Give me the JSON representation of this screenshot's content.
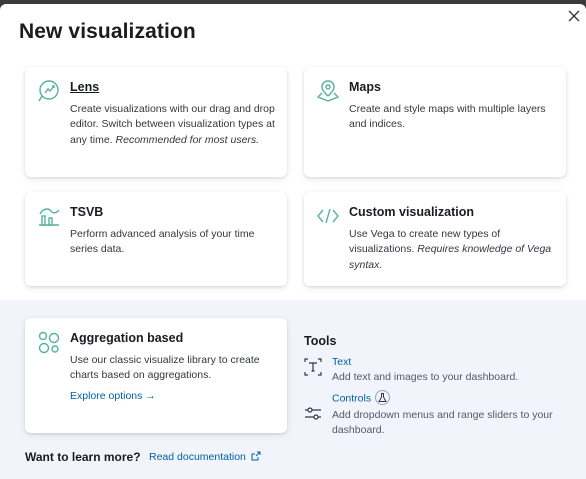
{
  "modal": {
    "title": "New visualization",
    "close_icon": "close-icon"
  },
  "cards": {
    "lens": {
      "title": "Lens",
      "desc_1": "Create visualizations with our drag and drop editor. Switch between visualization types at any time. ",
      "desc_em": "Recommended for most users.",
      "icon": "lens-icon"
    },
    "maps": {
      "title": "Maps",
      "desc": "Create and style maps with multiple layers and indices.",
      "icon": "maps-icon"
    },
    "tsvb": {
      "title": "TSVB",
      "desc": "Perform advanced analysis of your time series data.",
      "icon": "tsvb-icon"
    },
    "custom": {
      "title": "Custom visualization",
      "desc_1": "Use Vega to create new types of visualizations. ",
      "desc_em": "Requires knowledge of Vega syntax.",
      "icon": "code-icon"
    },
    "aggregation": {
      "title": "Aggregation based",
      "desc": "Use our classic visualize library to create charts based on aggregations.",
      "link": "Explore options →",
      "icon": "aggregation-icon"
    }
  },
  "tools": {
    "heading": "Tools",
    "items": [
      {
        "name": "Text",
        "desc": "Add text and images to your dashboard.",
        "icon": "text-icon"
      },
      {
        "name": "Controls",
        "desc": "Add dropdown menus and range sliders to your dashboard.",
        "icon": "controls-icon",
        "badge_icon": "beaker-icon"
      }
    ]
  },
  "footer": {
    "learn_more": "Want to learn more?",
    "read_docs": "Read documentation",
    "external_icon": "external-link-icon"
  },
  "colors": {
    "accent": "#54b399",
    "link": "#0061a6",
    "lower_bg": "#f1f4fa"
  }
}
